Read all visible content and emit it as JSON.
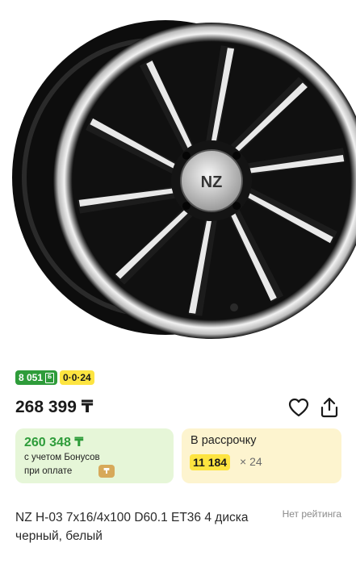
{
  "product_image": {
    "alt": "wheel-rim",
    "logo_text": "NZ"
  },
  "badges": [
    {
      "label": "8 051",
      "currency_glyph": "Б",
      "color": "#2e9c3a"
    },
    {
      "label": "0·0·24",
      "color": "#fde440"
    }
  ],
  "price": {
    "value": "268 399 ₸"
  },
  "actions": {
    "favorite_icon": "heart-icon",
    "share_icon": "share-icon"
  },
  "bonus_card": {
    "price": "260 348 ₸",
    "note_line1": "с учетом Бонусов",
    "note_line2": "при оплате",
    "coin_glyph": "₸"
  },
  "installment_card": {
    "title": "В рассрочку",
    "amount": "11 184",
    "multiplier": "× 24"
  },
  "product": {
    "title": "NZ H-03 7x16/4x100 D60.1 ET36 4 диска черный, белый",
    "rating_text": "Нет рейтинга"
  }
}
